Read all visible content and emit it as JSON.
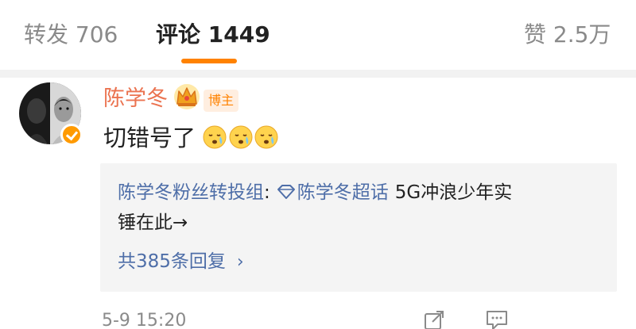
{
  "tabs": {
    "reposts": "转发 706",
    "comments": "评论 1449",
    "likes": "赞 2.5万"
  },
  "comment": {
    "username": "陈学冬",
    "badge": "博主",
    "text": "切错号了",
    "emoji_count": 3,
    "timestamp": "5-9 15:20"
  },
  "reply_preview": {
    "author": "陈学冬粉丝转投组",
    "separator": ":",
    "topic": "陈学冬超话",
    "body_line1": "5G冲浪少年实",
    "body_line2": "锤在此→",
    "view_all": "共385条回复",
    "view_all_arrow": "›"
  },
  "colors": {
    "accent": "#ff8200",
    "username": "#eb7350",
    "link": "#4e6ea8",
    "muted": "#8a8a8a"
  },
  "icons": [
    "crown-icon",
    "verified-icon",
    "supertopic-icon",
    "share-icon",
    "comment-icon",
    "crying-emoji-icon"
  ]
}
